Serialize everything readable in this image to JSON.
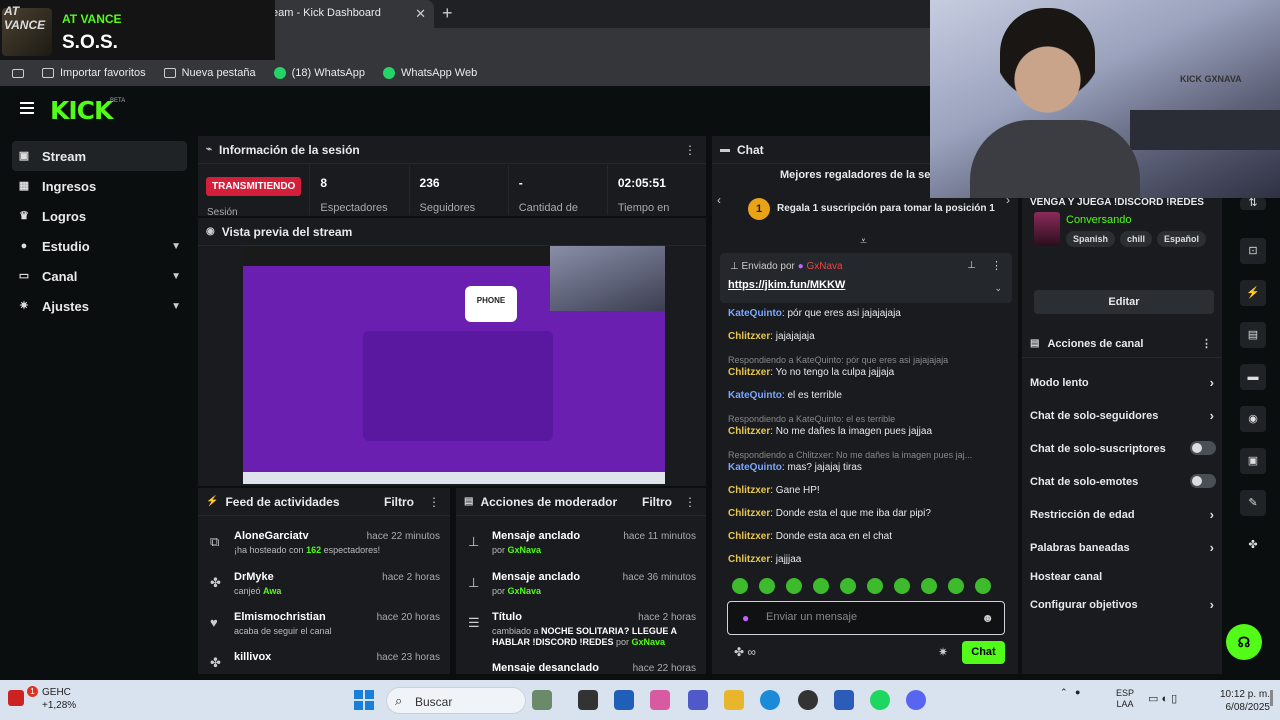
{
  "browser": {
    "tab_title": "eam - Kick Dashboard",
    "bookmarks": [
      "Importar favoritos",
      "Nueva pestaña",
      "(18) WhatsApp",
      "WhatsApp Web"
    ]
  },
  "overlay": {
    "avatar_text": "AT VANCE",
    "name": "AT VANCE",
    "song": "S.O.S."
  },
  "kick": {
    "logo": "KICK",
    "beta": "BETA"
  },
  "nav": {
    "items": [
      {
        "label": "Stream",
        "icon": "stream-icon"
      },
      {
        "label": "Ingresos",
        "icon": "revenue-icon"
      },
      {
        "label": "Logros",
        "icon": "trophy-icon"
      },
      {
        "label": "Estudio",
        "icon": "studio-icon"
      },
      {
        "label": "Canal",
        "icon": "channel-icon"
      },
      {
        "label": "Ajustes",
        "icon": "gear-icon"
      }
    ]
  },
  "session": {
    "title": "Información de la sesión",
    "live_badge": "TRANSMITIENDO",
    "session_label": "Sesión",
    "stats": [
      {
        "value": "",
        "label": ""
      },
      {
        "value": "8",
        "label": "Espectadores"
      },
      {
        "value": "236",
        "label": "Seguidores"
      },
      {
        "value": "-",
        "label": "Cantidad de"
      },
      {
        "value": "02:05:51",
        "label": "Tiempo en"
      }
    ]
  },
  "preview": {
    "title": "Vista previa del stream",
    "phone_text": "PHONE"
  },
  "feed": {
    "title": "Feed de actividades",
    "filter": "Filtro",
    "rows": [
      {
        "name": "AloneGarciatv",
        "time": "hace 22 minutos",
        "pre": "¡ha hosteado con ",
        "hl": "162",
        "post": " espectadores!"
      },
      {
        "name": "DrMyke",
        "time": "hace 2 horas",
        "pre": "canjeó ",
        "hl": "Awa",
        "post": ""
      },
      {
        "name": "Elmismochristian",
        "time": "hace 20 horas",
        "pre": "acaba de seguir el canal",
        "hl": "",
        "post": ""
      },
      {
        "name": "killivox",
        "time": "hace 23 horas",
        "pre": "",
        "hl": "",
        "post": ""
      }
    ]
  },
  "mod": {
    "title": "Acciones de moderador",
    "filter": "Filtro",
    "rows": [
      {
        "name": "Mensaje anclado",
        "time": "hace 11 minutos",
        "pre": "por ",
        "hl": "GxNava",
        "post": ""
      },
      {
        "name": "Mensaje anclado",
        "time": "hace 36 minutos",
        "pre": "por ",
        "hl": "GxNava",
        "post": ""
      },
      {
        "name": "Título",
        "time": "hace 2 horas",
        "pre": "cambiado a ",
        "hl2": "NOCHE SOLITARIA? LLEGUE A HABLAR !DISCORD !REDES",
        "mid": " por ",
        "hl": "GxNava"
      },
      {
        "name": "Mensaje desanclado",
        "time": "hace 22 horas",
        "pre": "",
        "hl": "",
        "post": ""
      }
    ]
  },
  "chat": {
    "title": "Chat",
    "top_gifters": "Mejores regaladores de la sen",
    "rank": "1",
    "gift_cta": "Regala 1 suscripción para tomar la posición 1",
    "pinned_by_label": "Enviado por",
    "pinned_by_user": "GxNava",
    "pinned_link": "https://jkim.fun/MKKW",
    "messages": [
      {
        "reply": "",
        "user": "KateQuinto",
        "text": "pór que eres asi jajajajaja",
        "kind": "k"
      },
      {
        "reply": "",
        "user": "Chlitzxer",
        "text": "jajajajaja",
        "kind": "u"
      },
      {
        "reply": "Respondiendo a KateQuinto: pór que eres asi jajajajaja",
        "user": "Chlitzxer",
        "text": "Yo no tengo la culpa jajjaja",
        "kind": "u"
      },
      {
        "reply": "",
        "user": "KateQuinto",
        "text": "el es terrible",
        "kind": "k"
      },
      {
        "reply": "Respondiendo a KateQuinto: el es terrible",
        "user": "Chlitzxer",
        "text": "No me dañes la imagen pues jajjaa",
        "kind": "u"
      },
      {
        "reply": "Respondiendo a Chlitzxer: No me dañes la imagen pues jaj...",
        "user": "KateQuinto",
        "text": "mas? jajajaj tiras",
        "kind": "k"
      },
      {
        "reply": "",
        "user": "Chlitzxer",
        "text": "Gane HP!",
        "kind": "u"
      },
      {
        "reply": "",
        "user": "Chlitzxer",
        "text": "Donde esta el que me iba dar pipi?",
        "kind": "u"
      },
      {
        "reply": "",
        "user": "Chlitzxer",
        "text": "Donde esta aca en el chat",
        "kind": "u"
      },
      {
        "reply": "",
        "user": "Chlitzxer",
        "text": "jajjjaa",
        "kind": "u"
      }
    ],
    "input_placeholder": "Enviar un mensaje",
    "send_button": "Chat"
  },
  "webcam": {
    "poster_text": "KICK GXNAVA"
  },
  "right": {
    "promo_title": "VENGA Y JUEGA !DISCORD !REDES",
    "status": "Conversando",
    "tags": [
      "Spanish",
      "chill",
      "Español"
    ],
    "edit_button": "Editar",
    "actions_title": "Acciones de canal",
    "actions": [
      {
        "label": "Modo lento",
        "type": "arrow"
      },
      {
        "label": "Chat de solo-seguidores",
        "type": "arrow"
      },
      {
        "label": "Chat de solo-suscriptores",
        "type": "toggle"
      },
      {
        "label": "Chat de solo-emotes",
        "type": "toggle"
      },
      {
        "label": "Restricción de edad",
        "type": "arrow"
      },
      {
        "label": "Palabras baneadas",
        "type": "arrow"
      },
      {
        "label": "Hostear canal",
        "type": "none"
      },
      {
        "label": "Configurar objetivos",
        "type": "arrow"
      }
    ]
  },
  "taskbar": {
    "stock_name": "GEHC",
    "stock_change": "+1,28%",
    "notif_count": "1",
    "search": "Buscar",
    "lang_top": "ESP",
    "lang_bottom": "LAA",
    "time": "10:12 p. m.",
    "date": "6/08/2025"
  },
  "colors": {
    "kick_green": "#53fc18",
    "live_red": "#d41f3b",
    "panel": "#191b1f",
    "username_yellow": "#e8c74e",
    "username_blue": "#7aa6ff"
  }
}
